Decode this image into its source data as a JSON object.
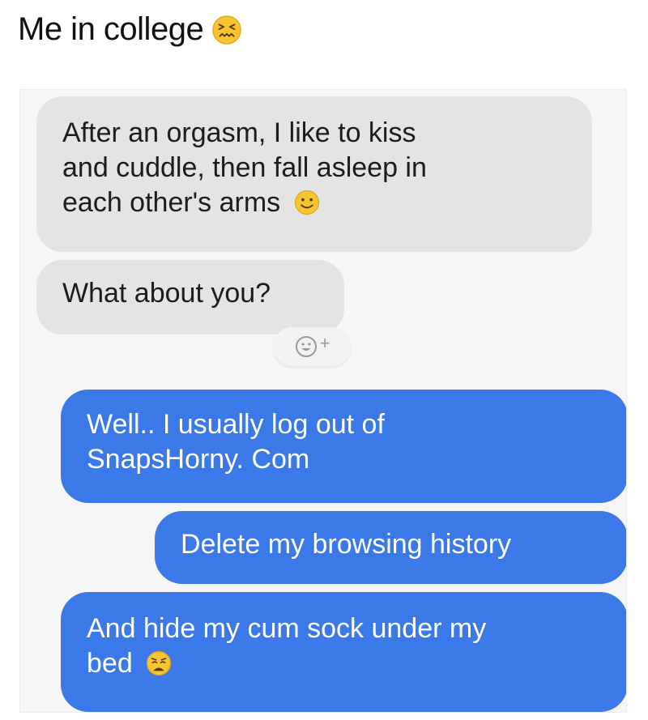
{
  "caption": {
    "text": "Me in college",
    "emoji": "confounded-face-icon"
  },
  "messages": [
    {
      "direction": "incoming",
      "lines": [
        "After an orgasm, I like to kiss",
        "and cuddle, then fall asleep in",
        "each other's arms"
      ],
      "emoji": "slightly-smiling-face-icon"
    },
    {
      "direction": "incoming",
      "lines": [
        "What about you?"
      ]
    },
    {
      "direction": "outgoing",
      "lines": [
        "Well.. I usually log out of",
        "SnapsHorny. Com"
      ]
    },
    {
      "direction": "outgoing",
      "lines": [
        "Delete my browsing history"
      ]
    },
    {
      "direction": "outgoing",
      "lines": [
        "And hide my cum sock under my",
        "bed"
      ],
      "emoji": "weary-face-icon"
    }
  ],
  "reaction_button": {
    "icon": "add-reaction-icon",
    "plus": "+"
  },
  "colors": {
    "incoming_bubble": "#e4e4e4",
    "outgoing_bubble": "#3b79e8",
    "emoji_yellow": "#f7c531"
  }
}
